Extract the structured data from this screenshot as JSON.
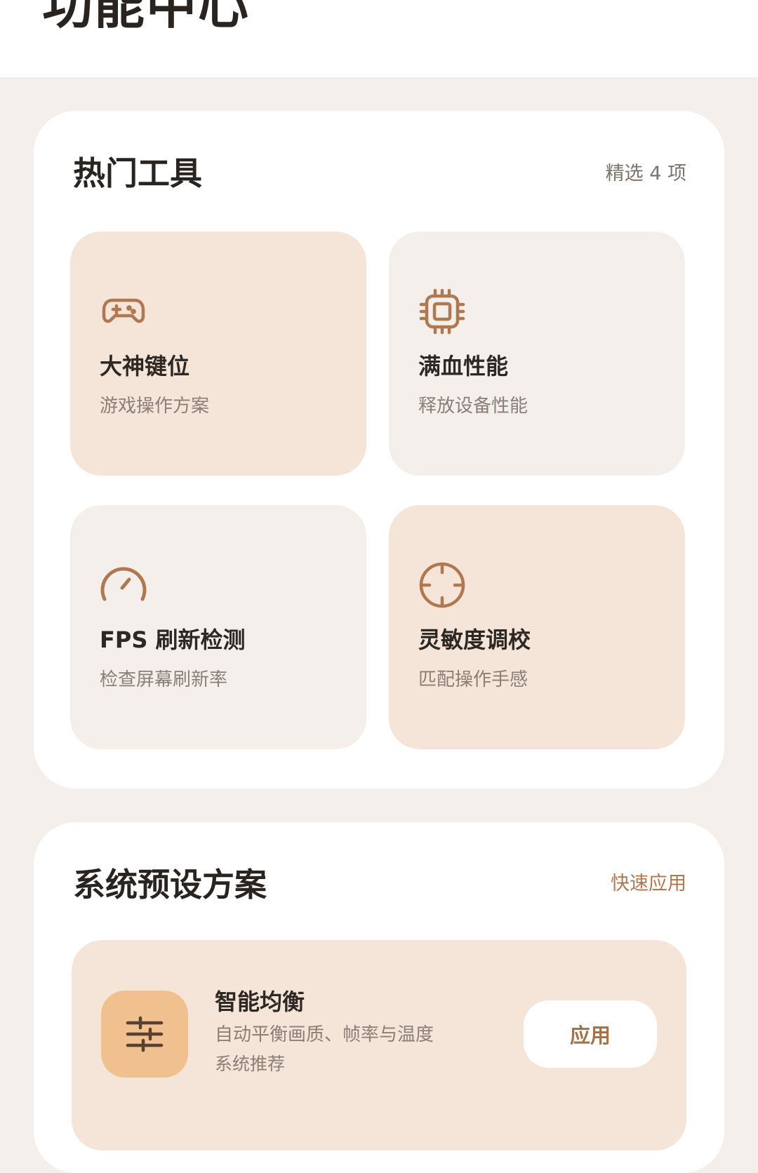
{
  "header": {
    "title": "功能中心"
  },
  "hot_tools": {
    "title": "热门工具",
    "meta": "精选 4 项",
    "tiles": [
      {
        "title": "大神键位",
        "subtitle": "游戏操作方案",
        "icon": "gamepad-icon"
      },
      {
        "title": "满血性能",
        "subtitle": "释放设备性能",
        "icon": "chip-icon"
      },
      {
        "title": "FPS 刷新检测",
        "subtitle": "检查屏幕刷新率",
        "icon": "speedometer-icon"
      },
      {
        "title": "灵敏度调校",
        "subtitle": "匹配操作手感",
        "icon": "crosshair-icon"
      }
    ]
  },
  "presets": {
    "title": "系统预设方案",
    "action": "快速应用",
    "items": [
      {
        "name": "智能均衡",
        "description": "自动平衡画质、帧率与温度",
        "tag": "系统推荐",
        "button": "应用",
        "icon": "sliders-icon"
      }
    ]
  },
  "colors": {
    "accent": "#b07850",
    "accent_text": "#a67248",
    "tile_peach": "#f5e5d8",
    "tile_grey": "#f4efeb",
    "icon_box": "#f0c08e",
    "background": "#f4efeb"
  }
}
